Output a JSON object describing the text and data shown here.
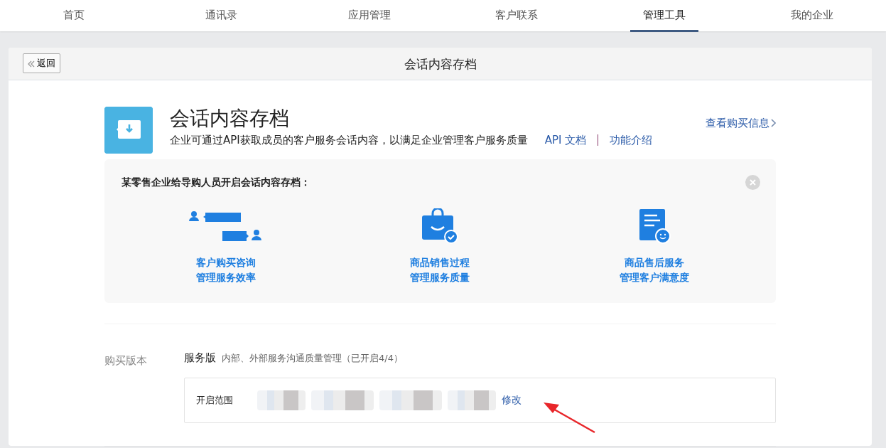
{
  "nav": [
    {
      "label": "首页",
      "selected": false
    },
    {
      "label": "通讯录",
      "selected": false
    },
    {
      "label": "应用管理",
      "selected": false
    },
    {
      "label": "客户联系",
      "selected": false
    },
    {
      "label": "管理工具",
      "selected": true
    },
    {
      "label": "我的企业",
      "selected": false
    }
  ],
  "header": {
    "back": "返回",
    "title": "会话内容存档"
  },
  "app": {
    "name": "会话内容存档",
    "description": "企业可通过API获取成员的客户服务会话内容，以满足企业管理客户服务质量",
    "links": [
      "API 文档",
      "功能介绍"
    ],
    "purchase_link": "查看购买信息"
  },
  "example": {
    "title": "某零售企业给导购人员开启会话内容存档：",
    "items": [
      {
        "kind": "chat",
        "lines": [
          "客户购买咨询",
          "管理服务效率"
        ]
      },
      {
        "kind": "bag",
        "lines": [
          "商品销售过程",
          "管理服务质量"
        ]
      },
      {
        "kind": "doc",
        "lines": [
          "商品售后服务",
          "管理客户满意度"
        ]
      }
    ]
  },
  "version": {
    "label": "购买版本",
    "name": "服务版",
    "detail": "内部、外部服务沟通质量管理（已开启4/4）",
    "scope_label": "开启范围",
    "edit": "修改"
  }
}
